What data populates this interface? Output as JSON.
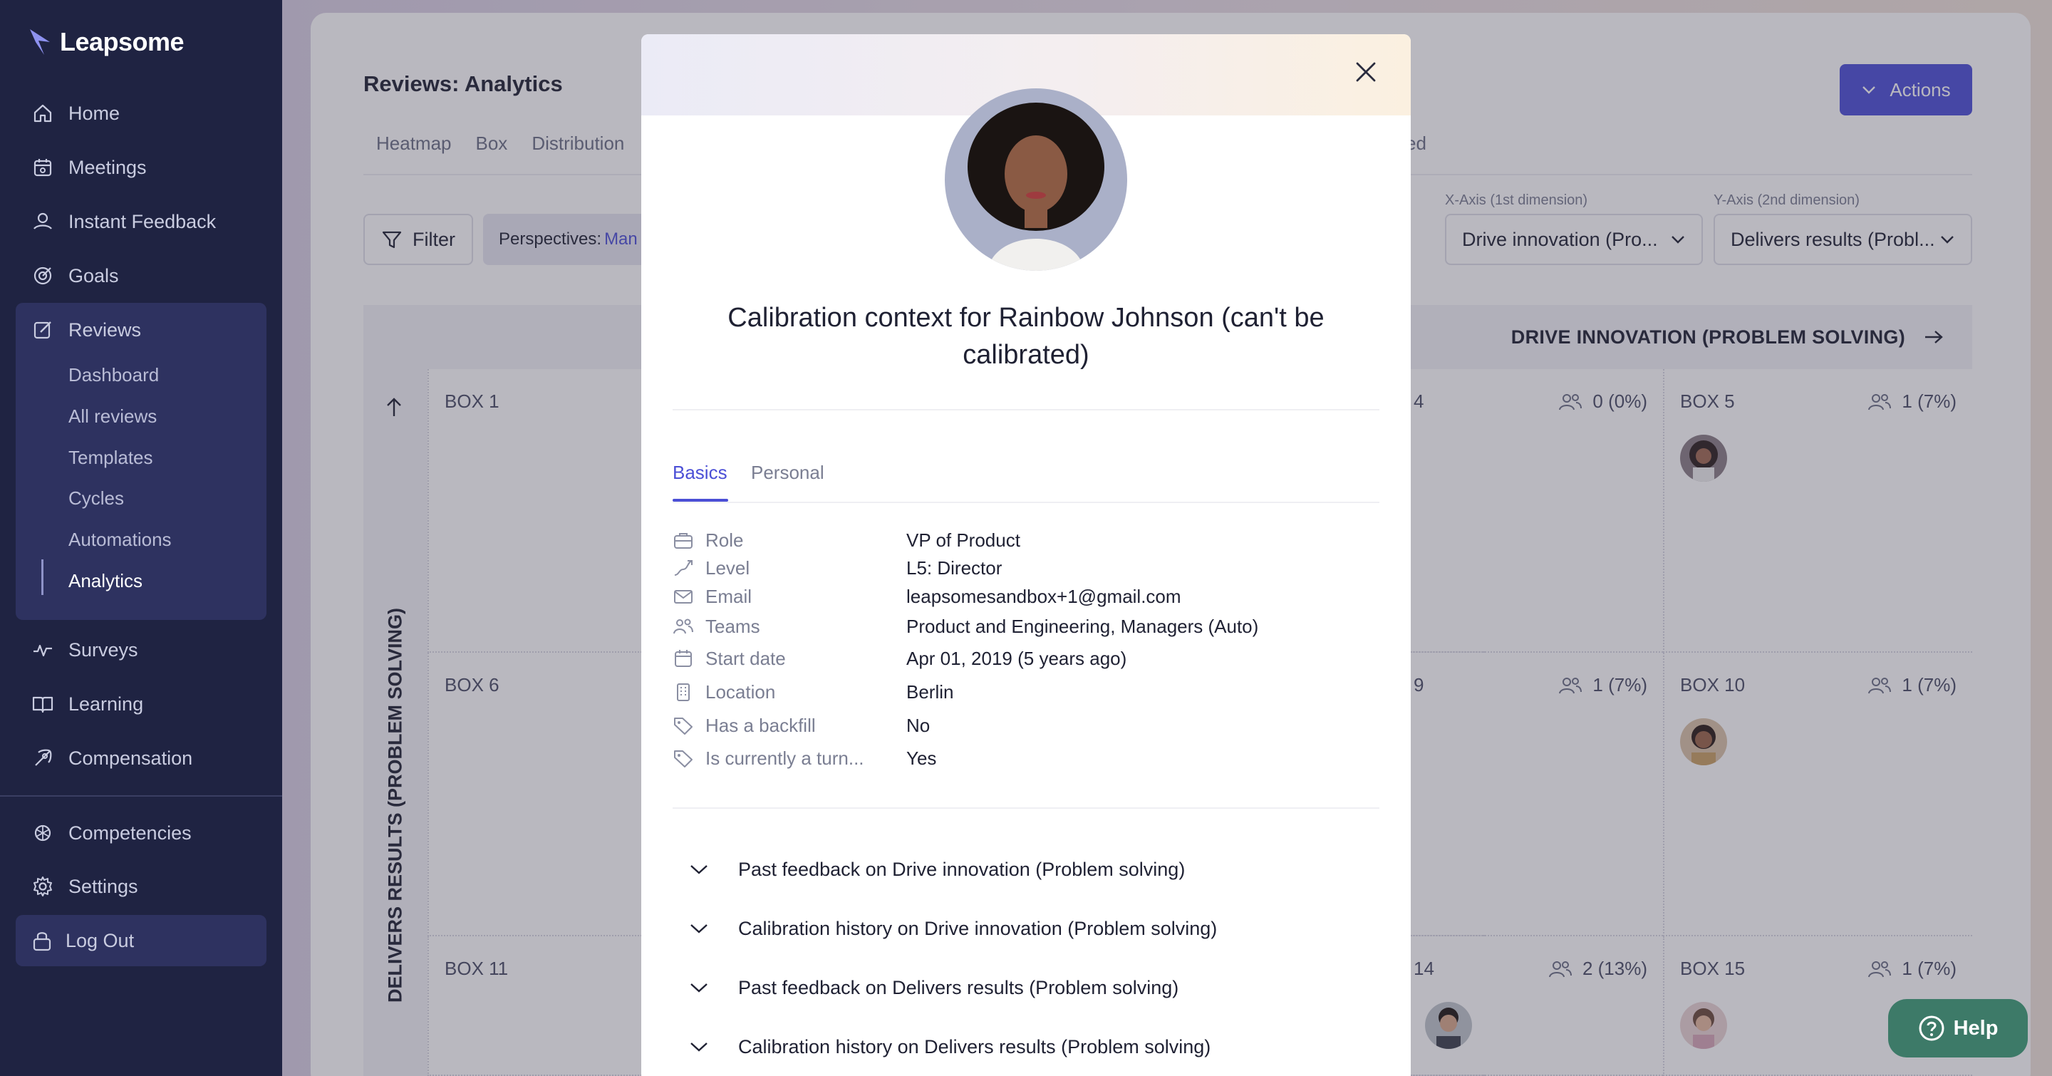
{
  "sidebar": {
    "brand": "Leapsome",
    "nav": [
      {
        "label": "Home",
        "icon": "home-icon"
      },
      {
        "label": "Meetings",
        "icon": "meetings-icon"
      },
      {
        "label": "Instant Feedback",
        "icon": "feedback-icon"
      },
      {
        "label": "Goals",
        "icon": "goals-icon"
      },
      {
        "label": "Reviews",
        "icon": "reviews-icon"
      },
      {
        "label": "Surveys",
        "icon": "surveys-icon"
      },
      {
        "label": "Learning",
        "icon": "learning-icon"
      },
      {
        "label": "Compensation",
        "icon": "compensation-icon"
      },
      {
        "label": "Competencies",
        "icon": "competencies-icon"
      },
      {
        "label": "Settings",
        "icon": "settings-icon"
      }
    ],
    "reviews_sub": [
      "Dashboard",
      "All reviews",
      "Templates",
      "Cycles",
      "Automations",
      "Analytics"
    ],
    "logout": "Log Out"
  },
  "main": {
    "title": "Reviews: Analytics",
    "tabs": [
      "Heatmap",
      "Box",
      "Distribution"
    ],
    "tab_fragment": "ved",
    "actions_label": "Actions",
    "filter_label": "Filter",
    "chip_label": "Perspectives:",
    "chip_value": "Man",
    "x_axis_label": "X-Axis (1st dimension)",
    "x_axis_value": "Drive innovation (Pro...",
    "y_axis_label": "Y-Axis (2nd dimension)",
    "y_axis_value": "Delivers results (Probl...",
    "grid_header": "DRIVE INNOVATION (PROBLEM SOLVING)",
    "y_axis_title": "DELIVERS RESULTS (PROBLEM SOLVING)",
    "cells": [
      {
        "title": "BOX 1",
        "count": ""
      },
      {
        "title": "4",
        "count": "0  (0%)"
      },
      {
        "title": "BOX 5",
        "count": "1  (7%)"
      },
      {
        "title": "BOX 6",
        "count": ""
      },
      {
        "title": "9",
        "count": "1  (7%)"
      },
      {
        "title": "BOX 10",
        "count": "1  (7%)"
      },
      {
        "title": "BOX 11",
        "count": ""
      },
      {
        "title": "14",
        "count": "2  (13%)"
      },
      {
        "title": "BOX 15",
        "count": "1  (7%)"
      }
    ],
    "help_label": "Help"
  },
  "modal": {
    "title": "Calibration context for Rainbow Johnson (can't be calibrated)",
    "tabs": [
      "Basics",
      "Personal"
    ],
    "details": [
      {
        "label": "Role",
        "value": "VP of Product",
        "icon": "briefcase-icon"
      },
      {
        "label": "Level",
        "value": "L5: Director",
        "icon": "level-icon"
      },
      {
        "label": "Email",
        "value": "leapsomesandbox+1@gmail.com",
        "icon": "mail-icon"
      },
      {
        "label": "Teams",
        "value": "Product and Engineering, Managers (Auto)",
        "icon": "teams-icon"
      },
      {
        "label": "Start date",
        "value": "Apr 01, 2019 (5 years ago)",
        "icon": "calendar-icon"
      },
      {
        "label": "Location",
        "value": "Berlin",
        "icon": "building-icon"
      },
      {
        "label": "Has a backfill",
        "value": "No",
        "icon": "tag-icon"
      },
      {
        "label": "Is currently a turn...",
        "value": "Yes",
        "icon": "tag-icon"
      }
    ],
    "accordions": [
      "Past feedback on Drive innovation (Problem solving)",
      "Calibration history on Drive innovation (Problem solving)",
      "Past feedback on Delivers results (Problem solving)",
      "Calibration history on Delivers results (Problem solving)"
    ]
  },
  "colors": {
    "sidebar_bg": "#1f2342",
    "accent": "#4b4fd6",
    "help_bg": "#3d7a68"
  }
}
